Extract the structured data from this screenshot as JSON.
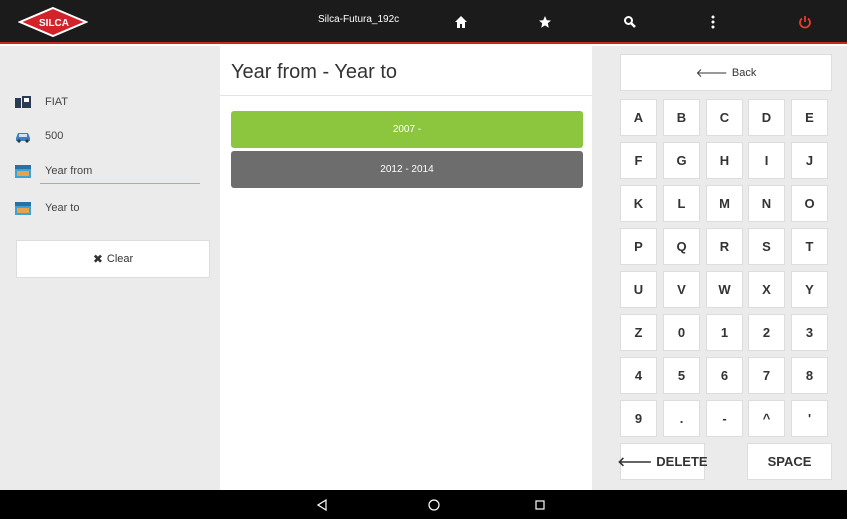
{
  "topbar": {
    "brand_logo_text": "SILCA",
    "device_name": "Silca-Futura_192c",
    "icons": [
      "home-icon",
      "star-icon",
      "search-icon",
      "more-vert-icon",
      "power-icon"
    ],
    "power_color": "#e63a2e"
  },
  "breadcrumbs": [
    {
      "label": "FIAT",
      "icon": "car-brand-icon"
    },
    {
      "label": "500",
      "icon": "car-icon"
    },
    {
      "label": "Year from",
      "icon": "calendar-icon"
    },
    {
      "label": "Year to",
      "icon": "calendar-icon"
    }
  ],
  "clear_label": "Clear",
  "main": {
    "title": "Year from - Year to",
    "options": [
      {
        "label": "2007 -",
        "color": "#8cc63f"
      },
      {
        "label": "2012 - 2014",
        "color": "#6d6d6d"
      }
    ]
  },
  "keyboard": {
    "back_label": "Back",
    "rows": [
      [
        "A",
        "B",
        "C",
        "D",
        "E"
      ],
      [
        "F",
        "G",
        "H",
        "I",
        "J"
      ],
      [
        "K",
        "L",
        "M",
        "N",
        "O"
      ],
      [
        "P",
        "Q",
        "R",
        "S",
        "T"
      ],
      [
        "U",
        "V",
        "W",
        "X",
        "Y"
      ],
      [
        "Z",
        "0",
        "1",
        "2",
        "3"
      ],
      [
        "4",
        "5",
        "6",
        "7",
        "8"
      ],
      [
        "9",
        ".",
        "-",
        "^",
        "'"
      ]
    ],
    "delete_label": "DELETE",
    "space_label": "SPACE"
  },
  "navbar": {
    "icons": [
      "back-icon",
      "home-circle-icon",
      "recents-icon"
    ]
  }
}
